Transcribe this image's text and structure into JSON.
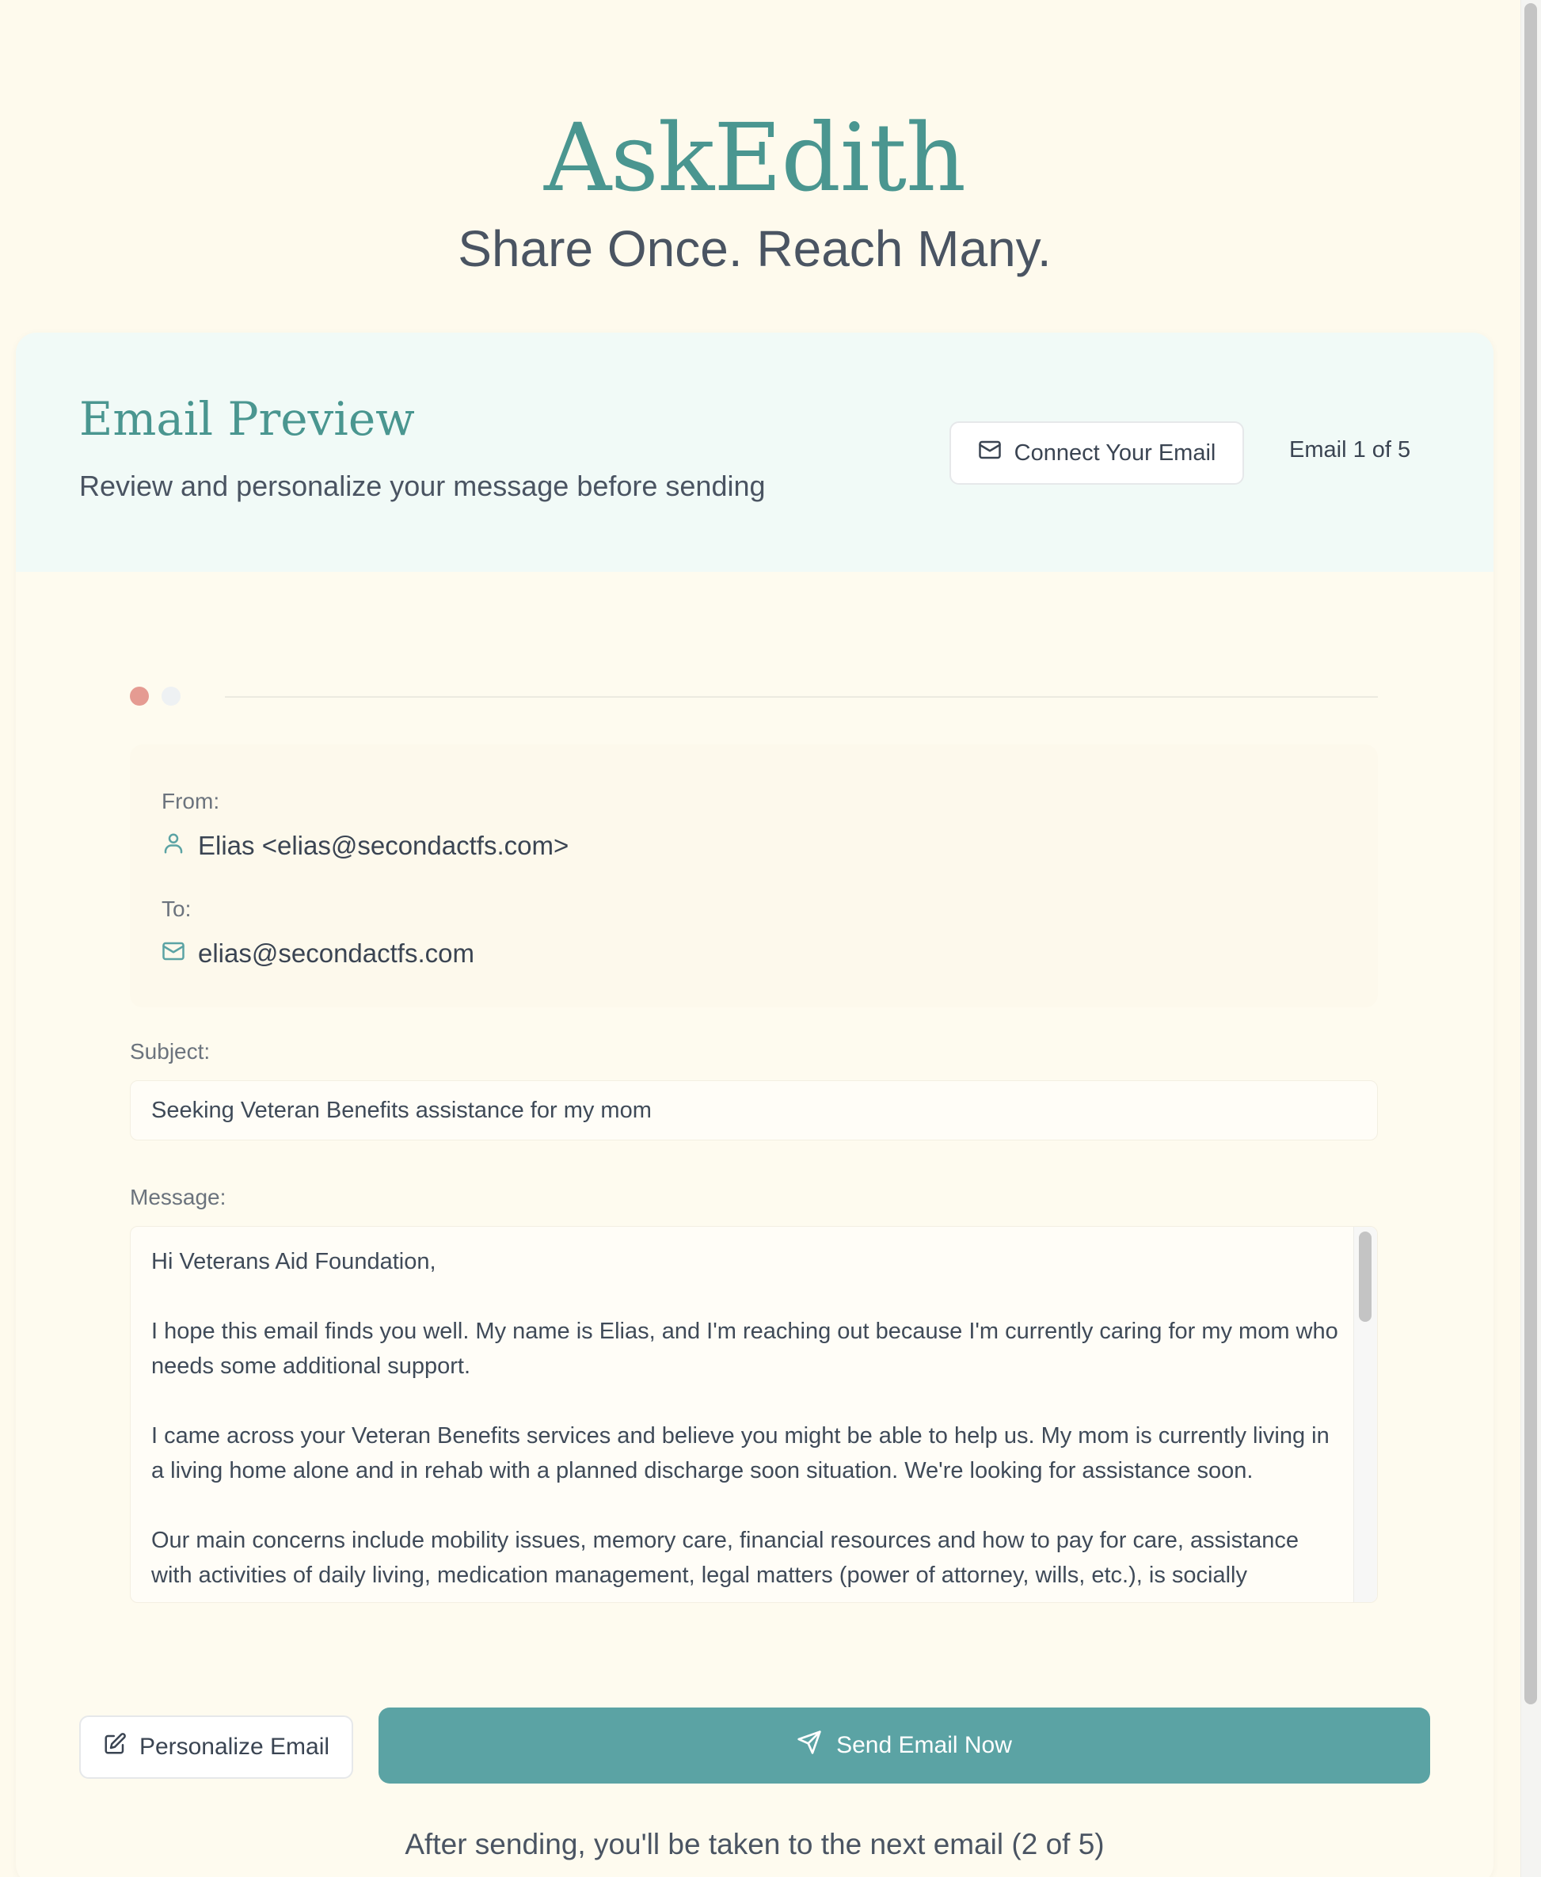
{
  "header": {
    "brand": "AskEdith",
    "tagline": "Share Once. Reach Many."
  },
  "card": {
    "title": "Email Preview",
    "subtitle": "Review and personalize your message before sending",
    "connect_label": "Connect Your Email",
    "email_counter": "Email 1 of 5"
  },
  "progress": {
    "current": 1,
    "dots": [
      "active",
      "inactive"
    ]
  },
  "from": {
    "label": "From:",
    "value": "Elias <elias@secondactfs.com>"
  },
  "to": {
    "label": "To:",
    "value": "elias@secondactfs.com"
  },
  "subject": {
    "label": "Subject:",
    "value": "Seeking Veteran Benefits assistance for my mom"
  },
  "message": {
    "label": "Message:",
    "body": "Hi Veterans Aid Foundation,\n\nI hope this email finds you well. My name is Elias, and I'm reaching out because I'm currently caring for my mom who needs some additional support.\n\nI came across your Veteran Benefits services and believe you might be able to help us. My mom is currently living in a living home alone and in rehab with a planned discharge soon situation. We're looking for assistance soon.\n\nOur main concerns include mobility issues, memory care, financial resources and how to pay for care, assistance with activities of daily living, medication management, legal matters (power of attorney, wills, etc.), is socially"
  },
  "actions": {
    "personalize_label": "Personalize Email",
    "send_label": "Send Email Now"
  },
  "footer_note": "After sending, you'll be taken to the next email (2 of 5)",
  "colors": {
    "brand": "#4a9690",
    "send_button": "#5ba3a4",
    "active_dot": "#e59b92",
    "header_band": "#f1faf7",
    "page_bg": "#fefaed"
  },
  "icons": {
    "connect": "mail-icon",
    "from": "user-icon",
    "to": "mail-icon",
    "personalize": "edit-icon",
    "send": "send-icon"
  }
}
